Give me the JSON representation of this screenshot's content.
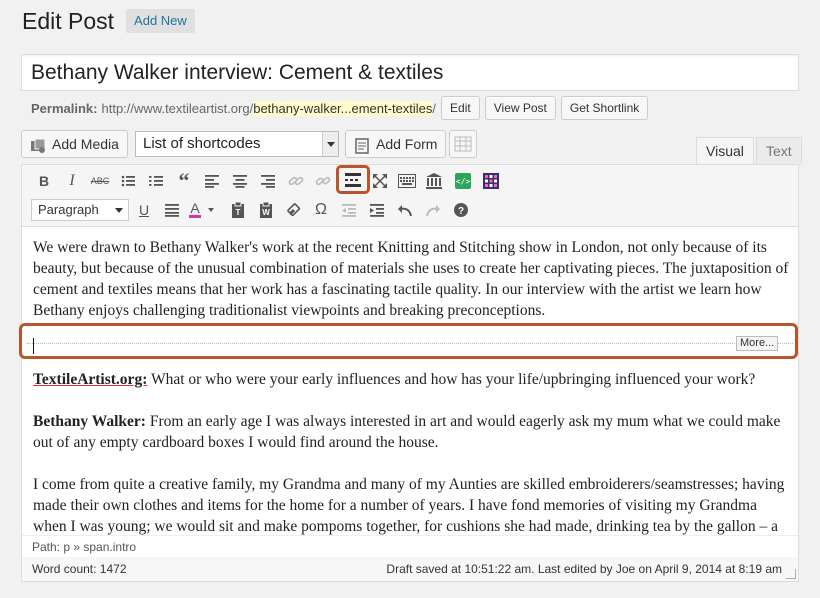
{
  "header": {
    "title": "Edit Post",
    "add_new": "Add New"
  },
  "post": {
    "title": "Bethany Walker interview: Cement & textiles"
  },
  "permalink": {
    "label": "Permalink:",
    "base": "http://www.textileartist.org/",
    "slug": "bethany-walker...ement-textiles",
    "trail": "/",
    "edit": "Edit",
    "view": "View Post",
    "shortlink": "Get Shortlink"
  },
  "media_bar": {
    "add_media": "Add Media",
    "shortcodes": "List of shortcodes",
    "add_form": "Add Form"
  },
  "tabs": {
    "visual": "Visual",
    "text": "Text"
  },
  "toolbar": {
    "row1": [
      "bold-icon",
      "italic-icon",
      "strikethrough-icon",
      "bullet-list-icon",
      "numbered-list-icon",
      "blockquote-icon",
      "align-left-icon",
      "align-center-icon",
      "align-right-icon",
      "link-icon",
      "unlink-icon",
      "read-more-icon",
      "fullscreen-icon",
      "keyboard-icon",
      "columns-icon",
      "code-icon",
      "grid-icon"
    ],
    "paragraph": "Paragraph",
    "row2": [
      "underline-icon",
      "justify-icon",
      "text-color-icon",
      "paste-text-icon",
      "paste-word-icon",
      "clear-format-icon",
      "special-char-icon",
      "outdent-icon",
      "indent-icon",
      "undo-icon",
      "redo-icon",
      "help-icon"
    ]
  },
  "content": {
    "intro": "We were drawn to Bethany Walker's work at the recent Knitting and Stitching show in London, not only because of its beauty, but because of the unusual combination of materials she uses to create her captivating pieces. The juxtaposition of cement and textiles means that her work has a fascinating tactile quality. In our interview with the artist we learn how Bethany enjoys challenging traditionalist viewpoints and breaking preconceptions.",
    "more_tag": "More...",
    "q1_label": "TextileArtist.org:",
    "q1": " What or who were your early influences and how has your life/upbringing influenced your work?",
    "a1_label": "Bethany Walker:",
    "a1": " From an early age I was always interested in art and would eagerly ask my mum what we could make out of any empty cardboard boxes I would find around the house.",
    "p3": "I come from quite a creative family, my Grandma and many of my Aunties are skilled embroiderers/seamstresses; having made their own clothes and items for the home for a number of years. I have fond memories of visiting my Grandma when I was young; we would sit and make pompoms together, for cushions she had made, drinking tea by the gallon – a real"
  },
  "path": "Path: p » span.intro",
  "status": {
    "word_count": "Word count: 1472",
    "draft": "Draft saved at 10:51:22 am. Last edited by Joe on April 9, 2014 at 8:19 am"
  },
  "colors": {
    "highlight": "#b8552b",
    "link": "#21759b"
  }
}
